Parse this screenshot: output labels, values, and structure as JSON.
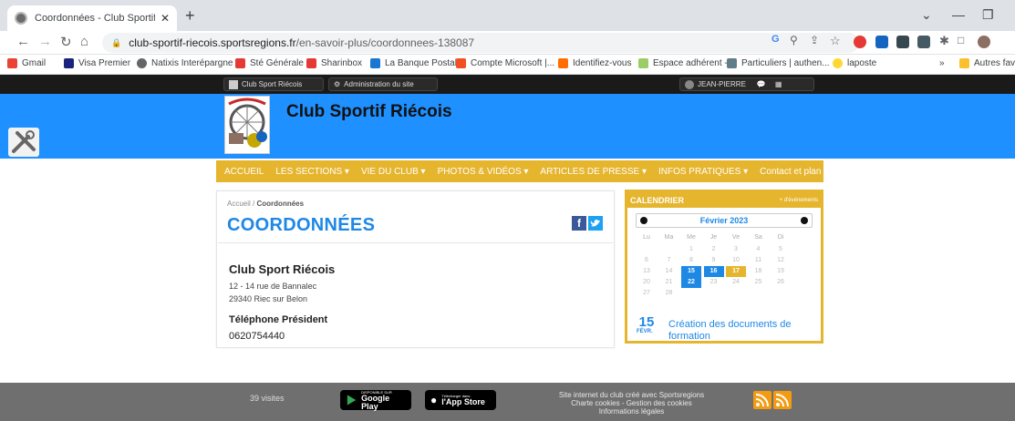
{
  "browser": {
    "tab_title": "Coordonnées - Club Sportif Riéco",
    "url_host": "club-sportif-riecois.sportsregions.fr",
    "url_path": "/en-savoir-plus/coordonnees-138087",
    "bookmarks": [
      "Gmail",
      "Visa Premier",
      "Natixis Interépargne",
      "Sté Générale",
      "Sharinbox",
      "La Banque Postale",
      "Compte Microsoft |...",
      "Identifiez-vous",
      "Espace adhérent -...",
      "Particuliers | authen...",
      "laposte",
      "Autres favo"
    ]
  },
  "topbar": {
    "site_link": "Club Sport Riécois",
    "admin_link": "Administration du site",
    "user": "JEAN-PIERRE"
  },
  "site": {
    "title": "Club Sportif Riécois"
  },
  "menu": [
    "ACCUEIL",
    "LES SECTIONS ▾",
    "VIE DU CLUB ▾",
    "PHOTOS & VIDÉOS ▾",
    "ARTICLES DE PRESSE ▾",
    "INFOS PRATIQUES ▾",
    "Contact et plan"
  ],
  "content": {
    "breadcrumb_home": "Accueil",
    "breadcrumb_sep": "/",
    "breadcrumb_current": "Coordonnées",
    "page_title": "COORDONNÉES",
    "club_name": "Club Sport Riécois",
    "address_line1": "12 - 14 rue de Bannalec",
    "address_line2": "29340 Riec sur Belon",
    "phone_label": "Téléphone Président",
    "phone_value": "0620754440"
  },
  "calendar": {
    "heading": "CALENDRIER",
    "more_link": "+ d'événements",
    "month": "Février 2023",
    "weekdays": [
      "Lu",
      "Ma",
      "Me",
      "Je",
      "Ve",
      "Sa",
      "Di"
    ],
    "weeks": [
      [
        "",
        "",
        "1",
        "2",
        "3",
        "4",
        "5"
      ],
      [
        "6",
        "7",
        "8",
        "9",
        "10",
        "11",
        "12"
      ],
      [
        "13",
        "14",
        "15",
        "16",
        "17",
        "18",
        "19"
      ],
      [
        "20",
        "21",
        "22",
        "23",
        "24",
        "25",
        "26"
      ],
      [
        "27",
        "28",
        "",
        "",
        "",
        "",
        ""
      ]
    ],
    "highlight_blue": [
      "15",
      "16",
      "22"
    ],
    "highlight_gold": [
      "17"
    ],
    "event_day": "15",
    "event_month": "FÉVR.",
    "event_title": "Création des documents de formation"
  },
  "footer": {
    "visits": "39 visites",
    "google_small": "DISPONIBLE SUR",
    "google_big": "Google Play",
    "apple_small": "Télécharger dans",
    "apple_big": "l'App Store",
    "credit_line1": "Site internet du club créé avec Sportsregions",
    "credit_line2": "Charte cookies - Gestion des cookies",
    "credit_line3": "Informations légales"
  },
  "colors": {
    "accent_blue": "#1e88e5",
    "gold": "#e6b52e",
    "hero": "#1e90ff"
  }
}
